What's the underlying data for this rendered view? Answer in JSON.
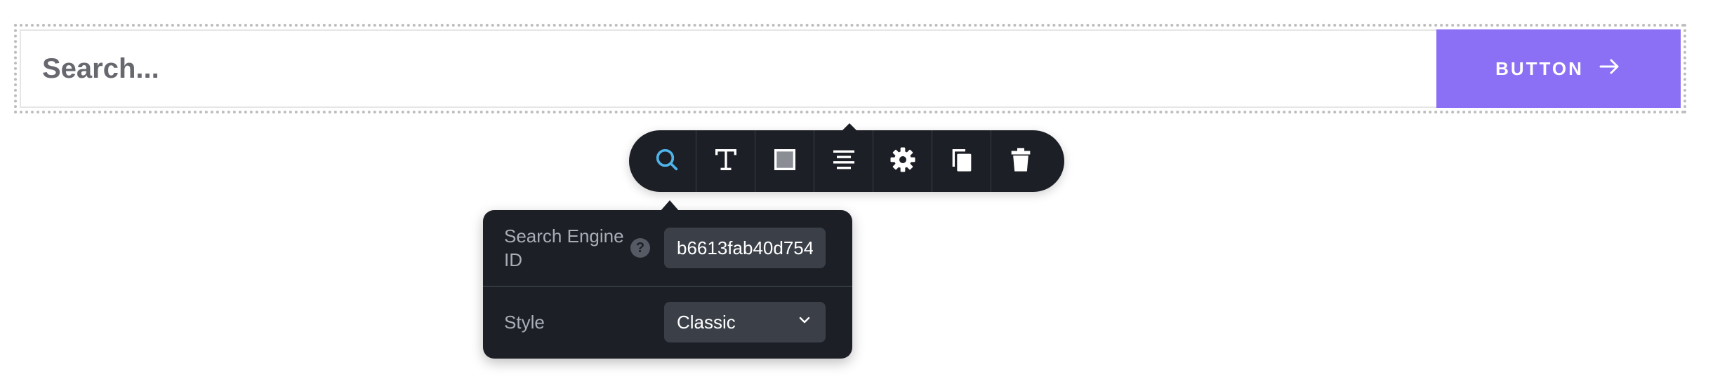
{
  "search": {
    "placeholder": "Search...",
    "button_label": "BUTTON"
  },
  "toolbar": {
    "tools": [
      {
        "name": "search",
        "icon": "search-icon",
        "active": true
      },
      {
        "name": "text",
        "icon": "text-icon"
      },
      {
        "name": "box",
        "icon": "square-icon"
      },
      {
        "name": "align",
        "icon": "align-center-icon"
      },
      {
        "name": "settings",
        "icon": "gear-icon"
      },
      {
        "name": "duplicate",
        "icon": "copy-icon"
      },
      {
        "name": "delete",
        "icon": "trash-icon"
      }
    ]
  },
  "popup": {
    "engine_label": "Search Engine ID",
    "engine_value": "b6613fab40d754",
    "style_label": "Style",
    "style_value": "Classic"
  },
  "colors": {
    "accent": "#8b6ff4",
    "toolbar_bg": "#1c1f26",
    "active_icon": "#4fb3e8"
  }
}
